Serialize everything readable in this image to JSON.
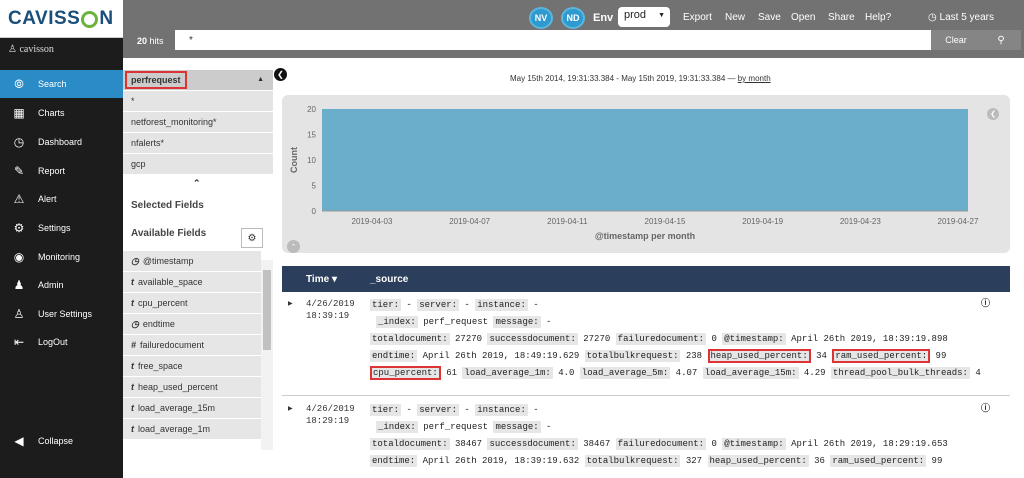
{
  "app": {
    "logo": "CAVISSON",
    "user": "cavisson"
  },
  "sidebar": {
    "items": [
      {
        "label": "Search",
        "icon": "compass-icon",
        "active": true
      },
      {
        "label": "Charts",
        "icon": "bar-chart-icon"
      },
      {
        "label": "Dashboard",
        "icon": "dashboard-icon"
      },
      {
        "label": "Report",
        "icon": "report-icon"
      },
      {
        "label": "Alert",
        "icon": "warning-icon"
      },
      {
        "label": "Settings",
        "icon": "gear-icon"
      },
      {
        "label": "Monitoring",
        "icon": "globe-icon"
      },
      {
        "label": "Admin",
        "icon": "user-icon"
      },
      {
        "label": "User Settings",
        "icon": "user-settings-icon"
      },
      {
        "label": "LogOut",
        "icon": "logout-icon"
      }
    ],
    "collapse": "Collapse"
  },
  "topbar": {
    "nv": "NV",
    "nd": "ND",
    "env_label": "Env",
    "env_value": "prod",
    "menu": [
      "Export",
      "New",
      "Save",
      "Open",
      "Share",
      "Help?"
    ],
    "timeline": "Last 5 years",
    "hits_count": "20",
    "hits_label": "hits",
    "query": "*",
    "clear": "Clear"
  },
  "fields": {
    "indices": [
      "perfrequest",
      "*",
      "netforest_monitoring*",
      "nfalerts*",
      "gcp"
    ],
    "selected_title": "Selected Fields",
    "available_title": "Available Fields",
    "available": [
      {
        "type": "clock-icon",
        "glyph": "◷",
        "name": "@timestamp"
      },
      {
        "type": "t",
        "glyph": "t",
        "name": "available_space"
      },
      {
        "type": "t",
        "glyph": "t",
        "name": "cpu_percent"
      },
      {
        "type": "clock-icon",
        "glyph": "◷",
        "name": "endtime"
      },
      {
        "type": "#",
        "glyph": "#",
        "name": "failuredocument"
      },
      {
        "type": "t",
        "glyph": "t",
        "name": "free_space"
      },
      {
        "type": "t",
        "glyph": "t",
        "name": "heap_used_percent"
      },
      {
        "type": "t",
        "glyph": "t",
        "name": "load_average_15m"
      },
      {
        "type": "t",
        "glyph": "t",
        "name": "load_average_1m"
      }
    ]
  },
  "main": {
    "range_text": "May 15th 2014, 19:31:33.384 - May 15th 2019, 19:31:33.384 —",
    "range_link": "by month",
    "table": {
      "col_time": "Time",
      "col_source": "_source"
    }
  },
  "chart_data": {
    "type": "bar",
    "categories": [
      "2019-04"
    ],
    "values": [
      20
    ],
    "ylabel": "Count",
    "xlabel": "@timestamp per month",
    "ylim": [
      0,
      20
    ],
    "yticks": [
      "20",
      "15",
      "10",
      "5",
      "0"
    ],
    "xticks": [
      "2019-04-03",
      "2019-04-07",
      "2019-04-11",
      "2019-04-15",
      "2019-04-19",
      "2019-04-23",
      "2019-04-27"
    ],
    "bar_color": "#6aaecb"
  },
  "rows": [
    {
      "date": "4/26/2019",
      "time": "18:39:19",
      "lines": [
        [
          [
            "tier:",
            "-"
          ],
          [
            "server:",
            "-"
          ],
          [
            "instance:",
            "-"
          ]
        ],
        [
          [
            "_index:",
            "perf_request"
          ],
          [
            "message:",
            "-"
          ]
        ],
        [
          [
            "totaldocument:",
            "27270"
          ],
          [
            "successdocument:",
            "27270"
          ],
          [
            "failuredocument:",
            "0"
          ],
          [
            "@timestamp:",
            "April 26th 2019, 18:39:19.898"
          ]
        ],
        [
          [
            "endtime:",
            "April 26th 2019, 18:49:19.629"
          ],
          [
            "totalbulkrequest:",
            "238"
          ],
          [
            "heap_used_percent:",
            "34",
            true
          ],
          [
            "ram_used_percent:",
            "99",
            true
          ]
        ],
        [
          [
            "cpu_percent:",
            "61",
            true
          ],
          [
            "load_average_1m:",
            "4.0"
          ],
          [
            "load_average_5m:",
            "4.07"
          ],
          [
            "load_average_15m:",
            "4.29"
          ],
          [
            "thread_pool_bulk_threads:",
            "4"
          ]
        ]
      ]
    },
    {
      "date": "4/26/2019",
      "time": "18:29:19",
      "lines": [
        [
          [
            "tier:",
            "-"
          ],
          [
            "server:",
            "-"
          ],
          [
            "instance:",
            "-"
          ]
        ],
        [
          [
            "_index:",
            "perf_request"
          ],
          [
            "message:",
            "-"
          ]
        ],
        [
          [
            "totaldocument:",
            "38467"
          ],
          [
            "successdocument:",
            "38467"
          ],
          [
            "failuredocument:",
            "0"
          ],
          [
            "@timestamp:",
            "April 26th 2019, 18:29:19.653"
          ]
        ],
        [
          [
            "endtime:",
            "April 26th 2019, 18:39:19.632"
          ],
          [
            "totalbulkrequest:",
            "327"
          ],
          [
            "heap_used_percent:",
            "36"
          ],
          [
            "ram_used_percent:",
            "99"
          ]
        ]
      ]
    }
  ]
}
